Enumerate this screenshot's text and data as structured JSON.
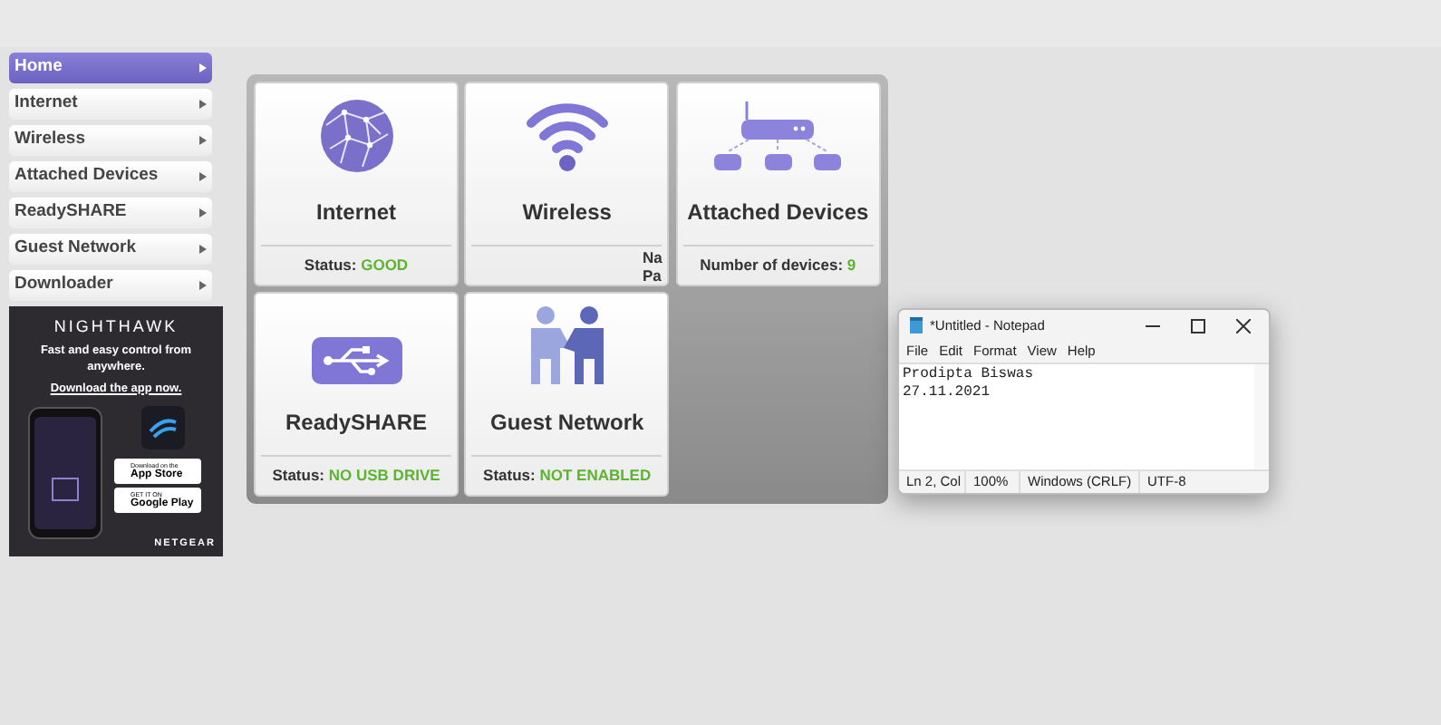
{
  "nav": [
    {
      "label": "Home",
      "selected": true
    },
    {
      "label": "Internet",
      "selected": false
    },
    {
      "label": "Wireless",
      "selected": false
    },
    {
      "label": "Attached Devices",
      "selected": false
    },
    {
      "label": "ReadySHARE",
      "selected": false
    },
    {
      "label": "Guest Network",
      "selected": false
    },
    {
      "label": "Downloader",
      "selected": false
    }
  ],
  "ad": {
    "brand": "NIGHTHAWK",
    "tagline": "Fast and easy control from anywhere.",
    "link": "Download the app now.",
    "app_store": {
      "small": "Download on the",
      "big": "App Store"
    },
    "google_play": {
      "small": "GET IT ON",
      "big": "Google Play"
    },
    "footer": "NETGEAR"
  },
  "tiles": [
    {
      "kind": "globe",
      "title": "Internet",
      "status_label": "Status:",
      "status_value": "GOOD"
    },
    {
      "kind": "wifi",
      "title": "Wireless",
      "cut_lines": [
        "Na",
        "Pa"
      ]
    },
    {
      "kind": "router",
      "title": "Attached Devices",
      "status_label": "Number of devices:",
      "status_value": "9"
    },
    {
      "kind": "usb",
      "title": "ReadySHARE",
      "status_label": "Status:",
      "status_value": "NO USB DRIVE"
    },
    {
      "kind": "people",
      "title": "Guest Network",
      "status_label": "Status:",
      "status_value": "NOT ENABLED"
    }
  ],
  "notepad": {
    "title": "*Untitled - Notepad",
    "menu": [
      "File",
      "Edit",
      "Format",
      "View",
      "Help"
    ],
    "lines": [
      "Prodipta Biswas",
      "27.11.2021"
    ],
    "status_bar": [
      "Ln 2, Col",
      "100%",
      "Windows (CRLF)",
      "UTF-8"
    ]
  }
}
